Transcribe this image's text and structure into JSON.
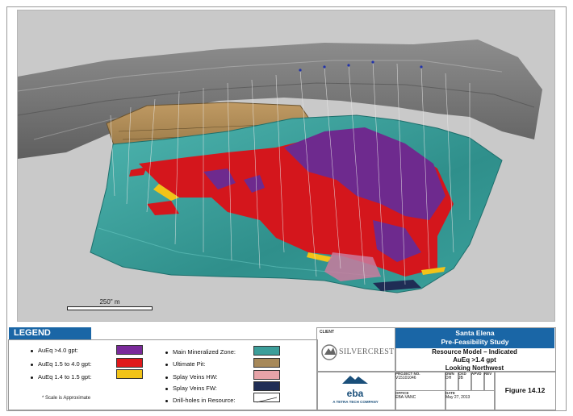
{
  "scale_bar": {
    "label": "250\" m"
  },
  "legend": {
    "title": "LEGEND",
    "grades": [
      {
        "label": "AuEq >4.0 gpt:",
        "color": "#7a2a9a"
      },
      {
        "label": "AuEq 1.5 to 4.0 gpt:",
        "color": "#e0191b"
      },
      {
        "label": "AuEq 1.4 to 1.5 gpt:",
        "color": "#f2c318"
      }
    ],
    "features": [
      {
        "label": "Main Mineralized Zone:",
        "color": "#3c9e9a"
      },
      {
        "label": "Ultimate Pit:",
        "color": "#a7895a"
      },
      {
        "label": "Splay Veins HW:",
        "color": "#e6a3a8"
      },
      {
        "label": "Splay Veins FW:",
        "color": "#1f2d55"
      },
      {
        "label": "Drill-holes in Resource:",
        "icon": "drill-hole-line-icon"
      }
    ],
    "note": "* Scale is Approximate"
  },
  "client": {
    "label": "CLIENT",
    "logo_text": "SILVERCREST"
  },
  "consultant": {
    "logo_text": "eba",
    "tagline": "A TETRA TECH COMPANY"
  },
  "title_block": {
    "line1": "Santa Elena",
    "line2": "Pre-Feasibility Study",
    "line3": "Resource Model – Indicated",
    "line4": "AuEq >1.4 gpt",
    "line5": "Looking Northwest"
  },
  "info": {
    "project_no_label": "PROJECT NO.",
    "project_no": "V15101046",
    "dwn_label": "DWN",
    "dwn": "DH",
    "ckd_label": "CKD",
    "ckd": "JB",
    "apvd_label": "APVD",
    "rev_label": "REV",
    "office_label": "OFFICE",
    "office": "EBA-VANC",
    "date_label": "DATE",
    "date": "May 27, 2013"
  },
  "figure": "Figure 14.12"
}
